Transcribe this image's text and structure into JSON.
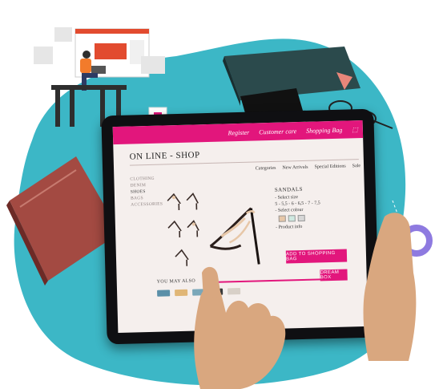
{
  "shop": {
    "topbar": {
      "register": "Register",
      "customer_care": "Customer care",
      "shopping_bag": "Shopping Bag"
    },
    "title": "ON LINE - SHOP",
    "nav": [
      "Categories",
      "New Arrivals",
      "Special Editions",
      "Sale"
    ],
    "sidebar": [
      "CLOTHING",
      "DENIM",
      "SHOES",
      "BAGS",
      "ACCESSORIES"
    ],
    "product": {
      "name": "SANDALS",
      "select_size": "- Select size",
      "sizes": "5 - 5,5 - 6 - 6,5 - 7 - 7,5",
      "select_colour": "- Select colour",
      "product_info": "- Product info"
    },
    "add_to_bag": "ADD TO SHOPPING BAG",
    "dream_box": "DREAM BOX",
    "you_may_also": "YOU MAY ALSO"
  },
  "colors": {
    "accent": "#e2167c",
    "background_blob": "#3cb7c6"
  },
  "icons": [
    "person-icon",
    "bag-icon",
    "sandal-image",
    "hand-image",
    "notebook-image",
    "glasses-image"
  ]
}
